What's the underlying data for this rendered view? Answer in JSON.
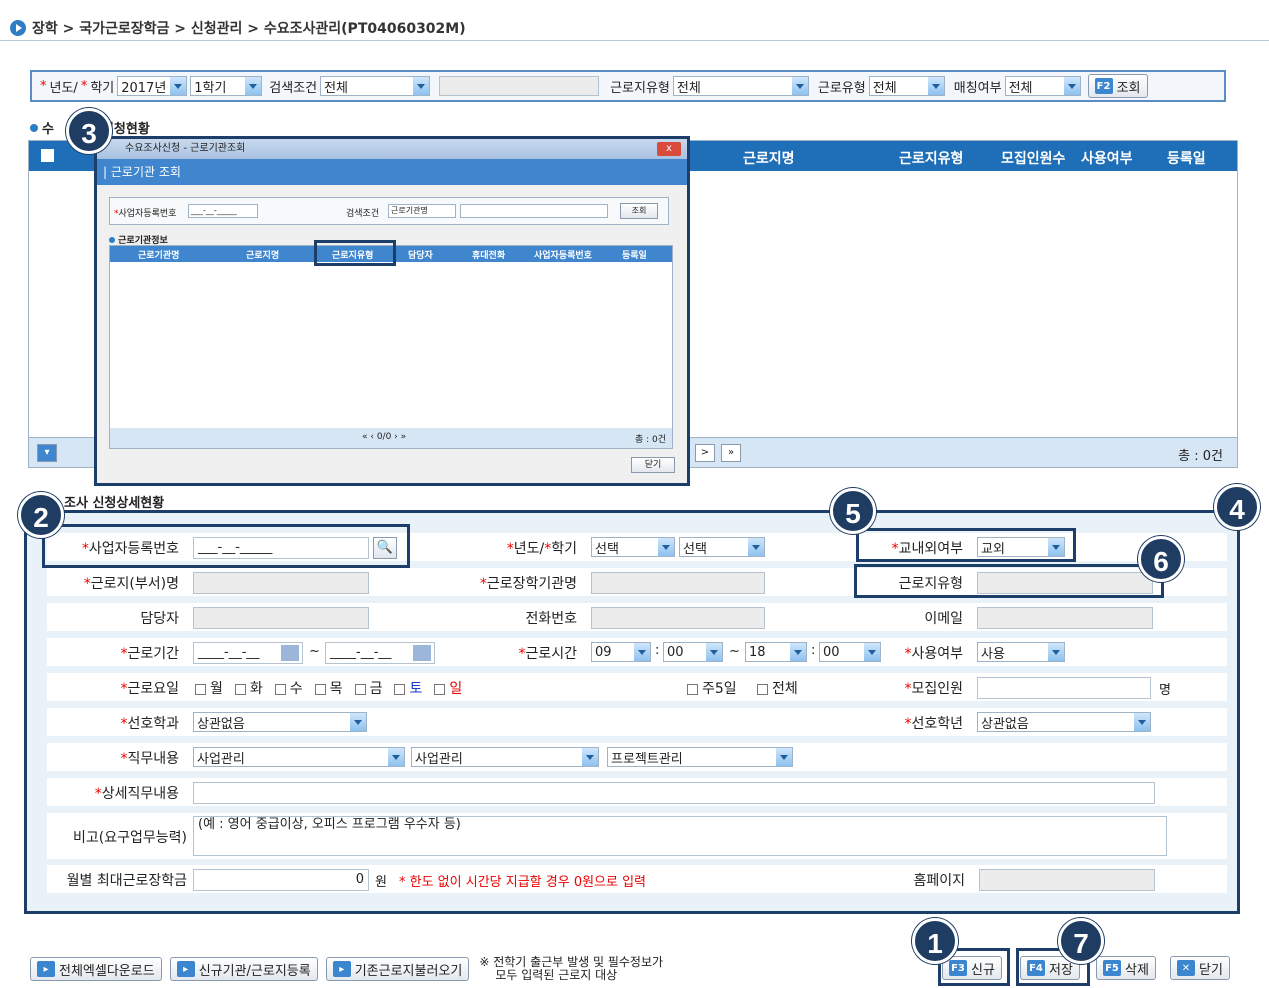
{
  "breadcrumb": "장학 > 국가근로장학금 > 신청관리 > 수요조사관리(PT04060302M)",
  "search": {
    "year_label": "년도/",
    "term_label": "학기",
    "year_value": "2017년",
    "term_value": "1학기",
    "condition_label": "검색조건",
    "condition_value": "전체",
    "worktype_label": "근로지유형",
    "worktype_value": "전체",
    "laborkind_label": "근로유형",
    "laborkind_value": "전체",
    "matching_label": "매칭여부",
    "matching_value": "전체",
    "search_button_key": "F2",
    "search_button_label": "조회"
  },
  "status_section": {
    "title_visible": "수",
    "title_rest": "신청현황",
    "columns": [
      "근로지명",
      "근로지유형",
      "모집인원수",
      "사용여부",
      "등록일"
    ],
    "total": "총 : 0건"
  },
  "modal": {
    "window_title": "수요조사신청 - 근로기관조회",
    "heading": "근로기관 조회",
    "biz_no_label": "사업자등록번호",
    "biz_no_value": "___-__-_____",
    "condition_label": "검색조건",
    "condition_value": "근로기관명",
    "search_button": "조회",
    "info_title": "근로기관정보",
    "columns": [
      "근로기관명",
      "근로지명",
      "근로지유형",
      "담당자",
      "휴대전화",
      "사업자등록번호",
      "등록일"
    ],
    "page_info": "0/0",
    "total": "총 : 0건",
    "close_button": "닫기",
    "close_x": "x"
  },
  "detail": {
    "title": "조사 신청상세현황",
    "biz_no_label": "사업자등록번호",
    "biz_no_value": "___-__-_____",
    "year_term_label_year": "년도/",
    "year_term_label_term": "학기",
    "year_select": "선택",
    "term_select": "선택",
    "inout_label": "교내외여부",
    "inout_value": "교외",
    "workplace_label": "근로지(부서)명",
    "institution_label": "근로장학기관명",
    "worktype_label": "근로지유형",
    "manager_label": "담당자",
    "phone_label": "전화번호",
    "email_label": "이메일",
    "period_label": "근로기간",
    "period_start": "____-__-__",
    "period_tilde": "~",
    "period_end": "____-__-__",
    "hours_label": "근로시간",
    "hour_start": "09",
    "min_start": "00",
    "hour_end": "18",
    "min_end": "00",
    "colon": ":",
    "use_label": "사용여부",
    "use_value": "사용",
    "days_label": "근로요일",
    "days": [
      {
        "name": "월",
        "color": "#222222"
      },
      {
        "name": "화",
        "color": "#222222"
      },
      {
        "name": "수",
        "color": "#222222"
      },
      {
        "name": "목",
        "color": "#222222"
      },
      {
        "name": "금",
        "color": "#222222"
      },
      {
        "name": "토",
        "color": "#1a3ccc"
      },
      {
        "name": "일",
        "color": "#e00000"
      }
    ],
    "five_day": "주5일",
    "all_days": "전체",
    "recruit_label": "모집인원",
    "recruit_unit": "명",
    "major_label": "선호학과",
    "major_value": "상관없음",
    "grade_label": "선호학년",
    "grade_value": "상관없음",
    "duty_label": "직무내용",
    "duty_1": "사업관리",
    "duty_2": "사업관리",
    "duty_3": "프로젝트관리",
    "duty_detail_label": "상세직무내용",
    "remark_label": "비고(요구업무능력)",
    "remark_value": "(예 : 영어 중급이상, 오피스 프로그램 우수자 등)",
    "monthly_label": "월별 최대근로장학금",
    "monthly_value": "0",
    "monthly_unit": "원",
    "monthly_note": "* 한도 없이 시간당 지급할 경우 0원으로 입력",
    "homepage_label": "홈페이지"
  },
  "bottom": {
    "excel": "전체엑셀다운로드",
    "new_inst": "신규기관/근로지등록",
    "load_prev": "기존근로지불러오기",
    "note_line1": "※ 전학기 출근부 발생 및 필수정보가",
    "note_line2": "모두 입력된 근로지 대상",
    "new_key": "F3",
    "new_label": "신규",
    "save_key": "F4",
    "save_label": "저장",
    "delete_key": "F5",
    "delete_label": "삭제",
    "close_label": "닫기"
  },
  "badges": [
    "1",
    "2",
    "3",
    "4",
    "5",
    "6",
    "7"
  ]
}
